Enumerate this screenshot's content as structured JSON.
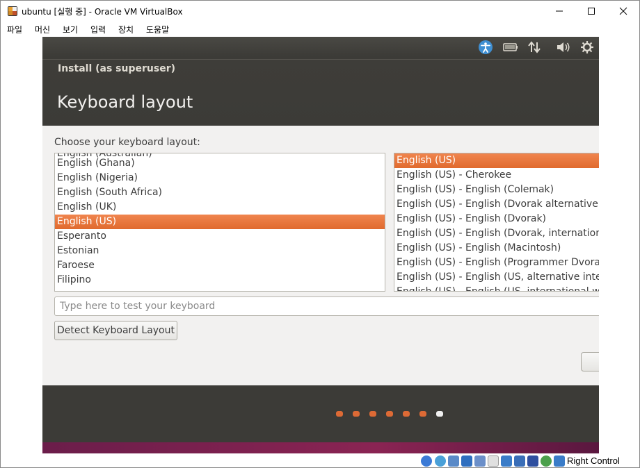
{
  "window": {
    "title": "ubuntu [실행 중] - Oracle VM VirtualBox"
  },
  "menubar": {
    "items": [
      "파일",
      "머신",
      "보기",
      "입력",
      "장치",
      "도움말"
    ]
  },
  "installer": {
    "window_title": "Install (as superuser)",
    "page_title": "Keyboard layout",
    "choose_label": "Choose your keyboard layout:",
    "left_list": {
      "items": [
        "English (Ghana)",
        "English (Nigeria)",
        "English (South Africa)",
        "English (UK)",
        "English (US)",
        "Esperanto",
        "Estonian",
        "Faroese",
        "Filipino"
      ],
      "selected": "English (US)"
    },
    "right_list": {
      "items": [
        "English (US)",
        "English (US) - Cherokee",
        "English (US) - English (Colemak)",
        "English (US) - English (Dvorak alternative in",
        "English (US) - English (Dvorak)",
        "English (US) - English (Dvorak, internationa",
        "English (US) - English (Macintosh)",
        "English (US) - English (Programmer Dvorak",
        "English (US) - English (US, alternative intern"
      ],
      "selected": "English (US)"
    },
    "test_input_placeholder": "Type here to test your keyboard",
    "detect_button": "Detect Keyboard Layout",
    "progress": {
      "total_steps": 7,
      "current_step": 7
    }
  },
  "statusbar": {
    "host_key": "Right Control"
  },
  "colors": {
    "accent_orange": "#e0692e",
    "ubuntu_dark": "#3c3b37",
    "content_bg": "#f2f1f0"
  }
}
